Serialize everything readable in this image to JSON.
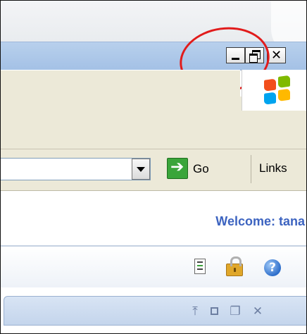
{
  "window": {
    "caption_buttons": {
      "minimize_icon": "minimize-icon",
      "restore_icon": "restore-icon",
      "close_label": "✕"
    },
    "highlight_color": "#e11b1b",
    "titlebar_color": "#b3cbea"
  },
  "address_bar": {
    "go_label": "Go",
    "links_label": "Links"
  },
  "page": {
    "welcome_text": "Welcome: tana",
    "welcome_color": "#3c63c0",
    "toolbar_icons": [
      "report-icon",
      "lock-icon",
      "help-icon"
    ],
    "help_glyph": "?"
  },
  "panel": {
    "pin_glyph": "⤒",
    "restore_glyph": "❐",
    "close_glyph": "✕"
  }
}
